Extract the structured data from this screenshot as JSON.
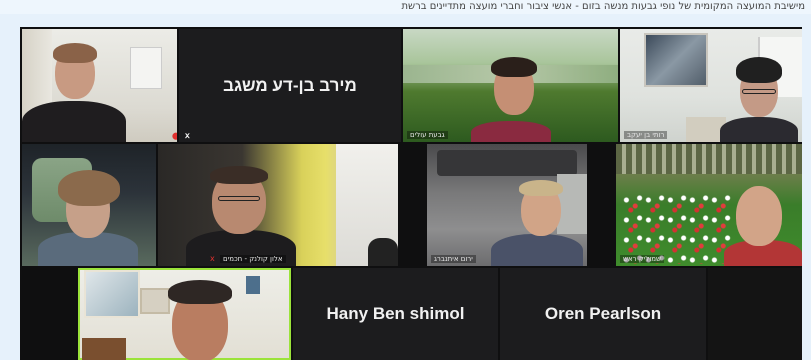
{
  "caption": "מישיבת המועצה המקומית של נופי גבעות מנשה בזום - אנשי ציבור וחברי מועצה מתדיינים ברשת",
  "participants": [
    {
      "id": "p1",
      "label": "",
      "muted": true
    },
    {
      "id": "p2",
      "display_name": "מירב בן-דע משגב",
      "camera_off": true,
      "muted": true
    },
    {
      "id": "p3",
      "label": "גבעת עולים",
      "muted": false
    },
    {
      "id": "p4",
      "label": "רותי בן יעקב",
      "muted": false
    },
    {
      "id": "p5",
      "label": "",
      "muted": false
    },
    {
      "id": "p6",
      "label": "אלון קולנק - חכמים",
      "muted": true
    },
    {
      "id": "p7",
      "label": "ירום איתנברג",
      "muted": false
    },
    {
      "id": "p8",
      "label": "שמוליק ראש",
      "muted": false
    },
    {
      "id": "p9",
      "label": "",
      "muted": false,
      "active_speaker": true
    },
    {
      "id": "p10",
      "display_name": "Hany Ben shimol",
      "camera_off": true
    },
    {
      "id": "p11",
      "display_name": "Oren Pearlson",
      "camera_off": true
    }
  ],
  "colors": {
    "active_speaker_border": "#9be33a",
    "muted_icon": "#e0312f",
    "grid_background": "#0f0f10"
  }
}
